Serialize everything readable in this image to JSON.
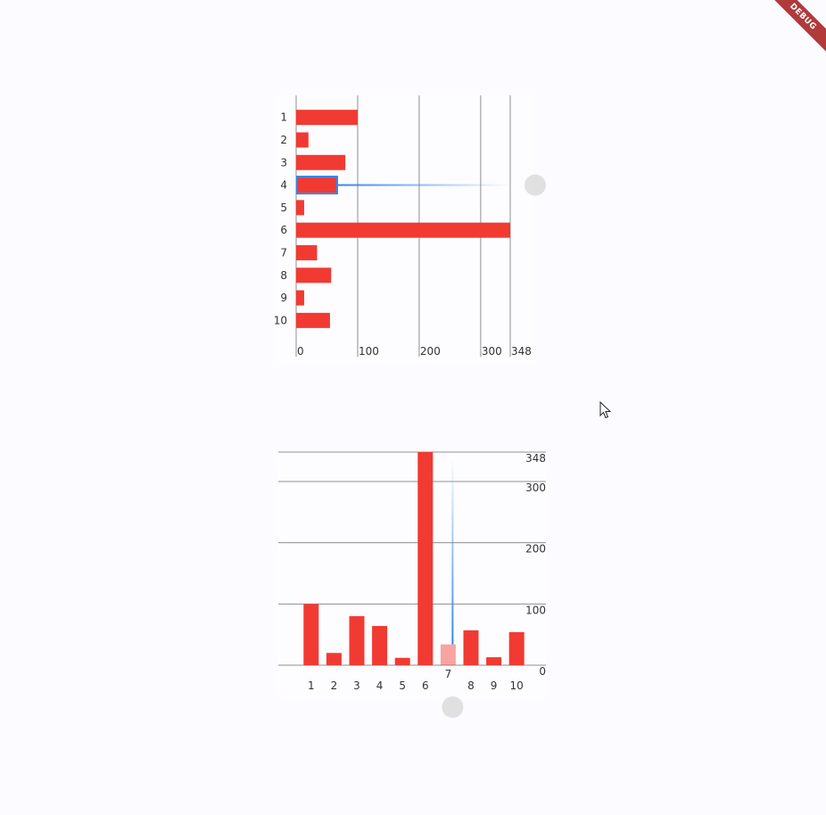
{
  "debug_banner": {
    "label": "DEBUG"
  },
  "chart_data": [
    {
      "type": "bar",
      "orientation": "horizontal",
      "categories": [
        "1",
        "2",
        "3",
        "4",
        "5",
        "6",
        "7",
        "8",
        "9",
        "10"
      ],
      "values": [
        100,
        20,
        80,
        68,
        13,
        348,
        34,
        57,
        13,
        55
      ],
      "xlim": [
        0,
        348
      ],
      "x_ticks": [
        0,
        100,
        200,
        300,
        348
      ],
      "grid": true,
      "selected_category": "4",
      "bar_color": "#f13a32",
      "highlight_color": "#2f86ee"
    },
    {
      "type": "bar",
      "orientation": "vertical",
      "categories": [
        "1",
        "2",
        "3",
        "4",
        "5",
        "6",
        "7",
        "8",
        "9",
        "10"
      ],
      "values": [
        100,
        20,
        80,
        64,
        12,
        348,
        34,
        57,
        13,
        54
      ],
      "ylim": [
        0,
        348
      ],
      "y_ticks": [
        0,
        100,
        200,
        300,
        348
      ],
      "grid": true,
      "selected_category": "7",
      "bar_color": "#f13a32",
      "highlight_color": "#2f86ee"
    }
  ]
}
